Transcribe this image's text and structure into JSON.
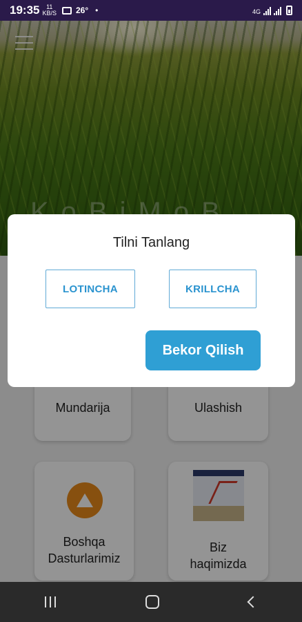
{
  "status_bar": {
    "time": "19:35",
    "indicator_top": "11",
    "indicator_bottom": "KB/S",
    "temperature": "26°",
    "dot": "•",
    "network_left": "4G",
    "icons": [
      "kb-speed-icon",
      "image-icon",
      "weather-icon",
      "signal-icon",
      "signal-icon",
      "battery-icon"
    ]
  },
  "header": {
    "menu_icon": "hamburger-menu-icon",
    "title": "KoBiMoB"
  },
  "cards": [
    {
      "label": "Mundarija"
    },
    {
      "label": "Ulashish"
    },
    {
      "label_line1": "Boshqa",
      "label_line2": "Dasturlarimiz",
      "icon": "mountain-icon"
    },
    {
      "label_line1": "Biz",
      "label_line2": "haqimizda",
      "icon": "team-photo-icon"
    }
  ],
  "dialog": {
    "title": "Tilni Tanlang",
    "option_latin": "LOTINCHA",
    "option_cyrillic": "KRILLCHA",
    "cancel": "Bekor Qilish",
    "accent_color": "#2f9fd4"
  },
  "nav_bar": {
    "icons": [
      "recent-apps-icon",
      "home-icon",
      "back-icon"
    ]
  }
}
